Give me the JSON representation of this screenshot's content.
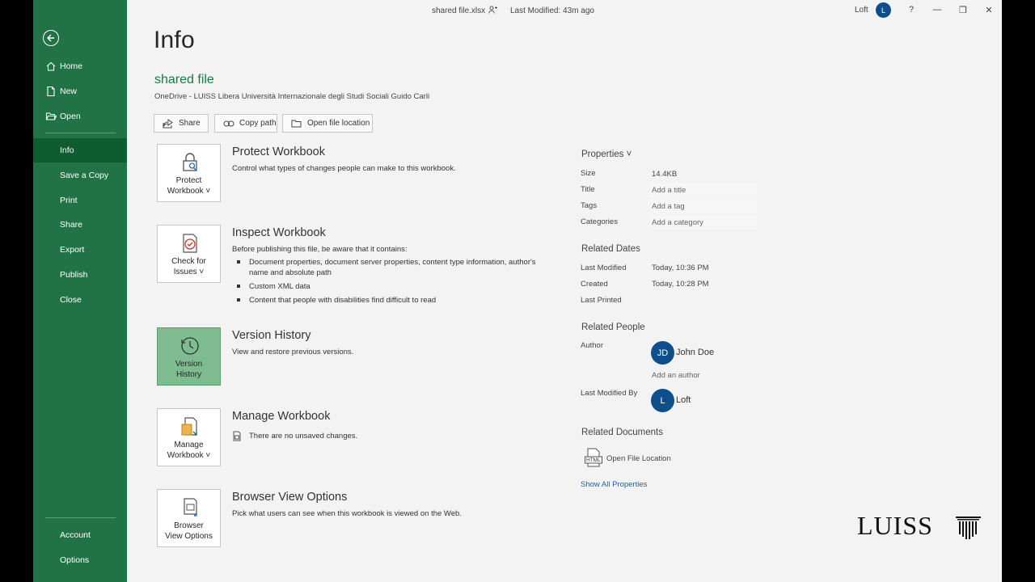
{
  "titlebar": {
    "filename": "shared file.xlsx",
    "last_modified": "Last Modified: 43m ago",
    "user": "Loft",
    "avatar_initial": "L",
    "help": "?",
    "minimize": "—",
    "restore": "❐",
    "close": "✕"
  },
  "sidebar": {
    "items": [
      {
        "label": "Home",
        "icon": "home-icon"
      },
      {
        "label": "New",
        "icon": "new-file-icon"
      },
      {
        "label": "Open",
        "icon": "folder-open-icon"
      },
      {
        "label": "Info",
        "active": true
      },
      {
        "label": "Save a Copy"
      },
      {
        "label": "Print"
      },
      {
        "label": "Share"
      },
      {
        "label": "Export"
      },
      {
        "label": "Publish"
      },
      {
        "label": "Close"
      }
    ],
    "bottom": [
      {
        "label": "Account"
      },
      {
        "label": "Options"
      }
    ]
  },
  "main": {
    "title": "Info",
    "file_name": "shared file",
    "file_location": "OneDrive - LUISS Libera Università Internazionale degli Studi Sociali Guido Carli",
    "actions": [
      {
        "label": "Share",
        "icon": "share-icon"
      },
      {
        "label": "Copy path",
        "icon": "link-icon"
      },
      {
        "label": "Open file location",
        "icon": "folder-icon"
      }
    ],
    "sections": {
      "protect": {
        "tile_line1": "Protect",
        "tile_line2": "Workbook ˅",
        "title": "Protect Workbook",
        "desc": "Control what types of changes people can make to this workbook."
      },
      "inspect": {
        "tile_line1": "Check for",
        "tile_line2": "Issues ˅",
        "title": "Inspect Workbook",
        "desc": "Before publishing this file, be aware that it contains:",
        "bullets": [
          "Document properties, document server properties, content type information, author's name and absolute path",
          "Custom XML data",
          "Content that people with disabilities find difficult to read"
        ]
      },
      "version": {
        "tile_line1": "Version",
        "tile_line2": "History",
        "title": "Version History",
        "desc": "View and restore previous versions."
      },
      "manage": {
        "tile_line1": "Manage",
        "tile_line2": "Workbook ˅",
        "title": "Manage Workbook",
        "desc": "There are no unsaved changes."
      },
      "browser": {
        "tile_line1": "Browser",
        "tile_line2": "View Options",
        "title": "Browser View Options",
        "desc": "Pick what users can see when this workbook is viewed on the Web."
      }
    }
  },
  "properties": {
    "heading": "Properties ˅",
    "rows": [
      {
        "label": "Size",
        "value": "14.4KB"
      },
      {
        "label": "Title",
        "value": "Add a title"
      },
      {
        "label": "Tags",
        "value": "Add a tag"
      },
      {
        "label": "Categories",
        "value": "Add a category"
      }
    ],
    "related_dates": {
      "heading": "Related Dates",
      "rows": [
        {
          "label": "Last Modified",
          "value": "Today, 10:36 PM"
        },
        {
          "label": "Created",
          "value": "Today, 10:28 PM"
        },
        {
          "label": "Last Printed",
          "value": ""
        }
      ]
    },
    "related_people": {
      "heading": "Related People",
      "author_label": "Author",
      "author_initials": "JD",
      "author_name": "John Doe",
      "add_author": "Add an author",
      "modified_by_label": "Last Modified By",
      "modified_by_initial": "L",
      "modified_by_name": "Loft"
    },
    "related_documents": {
      "heading": "Related Documents",
      "open_location": "Open File Location",
      "icon_text": "HTML"
    },
    "show_all": "Show All Properties"
  },
  "branding": {
    "logo_text": "LUISS"
  },
  "colors": {
    "accent": "#217346",
    "accent_dark": "#0e5c2f",
    "tile_hover": "#7ebb8f",
    "avatar": "#0e4e8a",
    "link": "#1e5fa6"
  }
}
